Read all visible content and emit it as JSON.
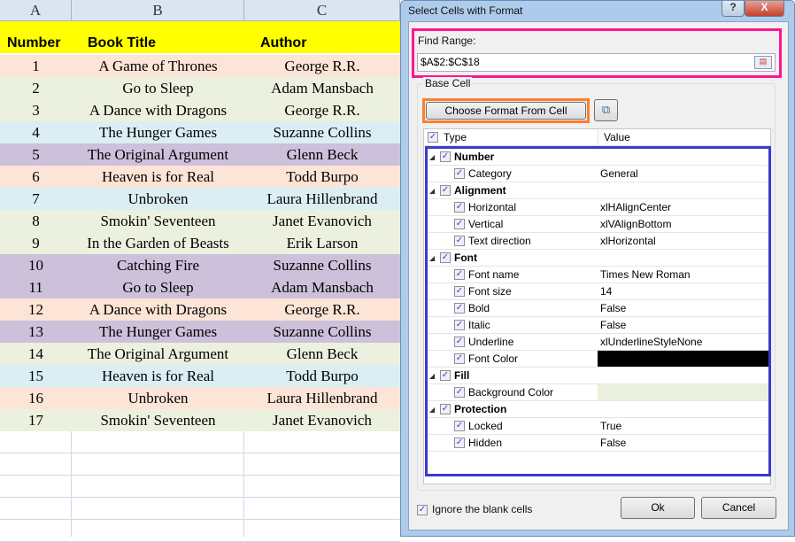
{
  "sheet": {
    "columns": [
      "A",
      "B",
      "C"
    ],
    "headers": {
      "number": "Number",
      "title": "Book Title",
      "author": "Author"
    },
    "rows": [
      {
        "n": "1",
        "title": "A Game of Thrones",
        "author": "George R.R.",
        "color": "#fce4d6"
      },
      {
        "n": "2",
        "title": "Go to Sleep",
        "author": "Adam Mansbach",
        "color": "#ebf1de"
      },
      {
        "n": "3",
        "title": "A Dance with Dragons",
        "author": "George R.R.",
        "color": "#ebf1de"
      },
      {
        "n": "4",
        "title": "The Hunger Games",
        "author": "Suzanne Collins",
        "color": "#daeef3"
      },
      {
        "n": "5",
        "title": "The Original Argument",
        "author": "Glenn Beck",
        "color": "#ccc0da"
      },
      {
        "n": "6",
        "title": "Heaven is for Real",
        "author": "Todd Burpo",
        "color": "#fce4d6"
      },
      {
        "n": "7",
        "title": "Unbroken",
        "author": "Laura Hillenbrand",
        "color": "#daeef3"
      },
      {
        "n": "8",
        "title": "Smokin' Seventeen",
        "author": "Janet Evanovich",
        "color": "#ebf1de"
      },
      {
        "n": "9",
        "title": "In the Garden of Beasts",
        "author": "Erik Larson",
        "color": "#ebf1de"
      },
      {
        "n": "10",
        "title": "Catching Fire",
        "author": "Suzanne Collins",
        "color": "#ccc0da"
      },
      {
        "n": "11",
        "title": "Go to Sleep",
        "author": "Adam Mansbach",
        "color": "#ccc0da"
      },
      {
        "n": "12",
        "title": "A Dance with Dragons",
        "author": "George R.R.",
        "color": "#fce4d6"
      },
      {
        "n": "13",
        "title": "The Hunger Games",
        "author": "Suzanne Collins",
        "color": "#ccc0da"
      },
      {
        "n": "14",
        "title": "The Original Argument",
        "author": "Glenn Beck",
        "color": "#ebf1de"
      },
      {
        "n": "15",
        "title": "Heaven is for Real",
        "author": "Todd Burpo",
        "color": "#daeef3"
      },
      {
        "n": "16",
        "title": "Unbroken",
        "author": "Laura Hillenbrand",
        "color": "#fce4d6"
      },
      {
        "n": "17",
        "title": "Smokin' Seventeen",
        "author": "Janet Evanovich",
        "color": "#ebf1de"
      }
    ]
  },
  "dialog": {
    "title": "Select Cells with Format",
    "help_label": "?",
    "close_label": "X",
    "find_range_label": "Find Range:",
    "find_range_value": "$A$2:$C$18",
    "base_cell_label": "Base Cell",
    "choose_format_label": "Choose Format From Cell",
    "tree_headers": {
      "type": "Type",
      "value": "Value"
    },
    "tree": [
      {
        "level": 0,
        "label": "Number",
        "value": ""
      },
      {
        "level": 1,
        "label": "Category",
        "value": "General"
      },
      {
        "level": 0,
        "label": "Alignment",
        "value": ""
      },
      {
        "level": 1,
        "label": "Horizontal",
        "value": "xlHAlignCenter"
      },
      {
        "level": 1,
        "label": "Vertical",
        "value": "xlVAlignBottom"
      },
      {
        "level": 1,
        "label": "Text direction",
        "value": "xlHorizontal"
      },
      {
        "level": 0,
        "label": "Font",
        "value": ""
      },
      {
        "level": 1,
        "label": "Font name",
        "value": "Times New Roman"
      },
      {
        "level": 1,
        "label": "Font size",
        "value": "14"
      },
      {
        "level": 1,
        "label": "Bold",
        "value": "False"
      },
      {
        "level": 1,
        "label": "Italic",
        "value": "False"
      },
      {
        "level": 1,
        "label": "Underline",
        "value": "xlUnderlineStyleNone"
      },
      {
        "level": 1,
        "label": "Font Color",
        "value": "",
        "swatch": "#000000"
      },
      {
        "level": 0,
        "label": "Fill",
        "value": ""
      },
      {
        "level": 1,
        "label": "Background Color",
        "value": "",
        "swatch": "#ebf1de"
      },
      {
        "level": 0,
        "label": "Protection",
        "value": ""
      },
      {
        "level": 1,
        "label": "Locked",
        "value": "True"
      },
      {
        "level": 1,
        "label": "Hidden",
        "value": "False"
      }
    ],
    "ignore_blank_label": "Ignore the blank cells",
    "ignore_blank_checked": true,
    "ok_label": "Ok",
    "cancel_label": "Cancel"
  }
}
